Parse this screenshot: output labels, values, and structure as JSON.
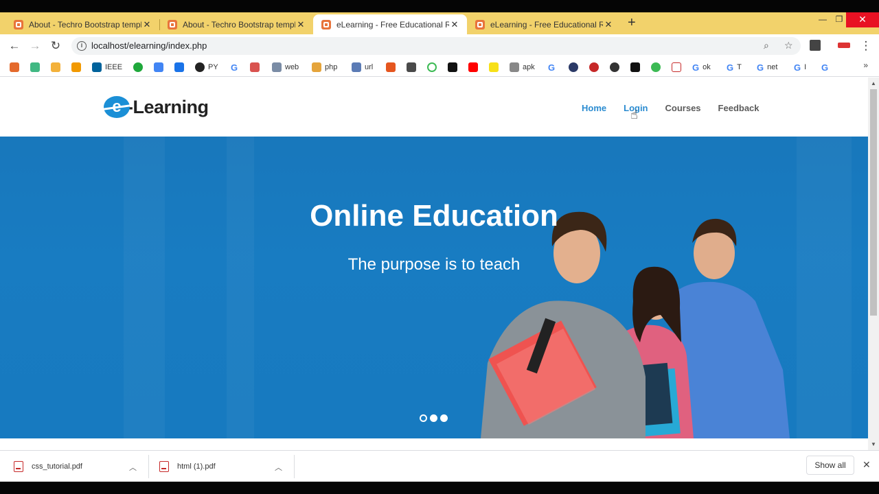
{
  "browser": {
    "tabs": [
      {
        "title": "About - Techro Bootstrap template",
        "active": false
      },
      {
        "title": "About - Techro Bootstrap template",
        "active": false
      },
      {
        "title": "eLearning - Free Educational Res",
        "active": true
      },
      {
        "title": "eLearning - Free Educational Res",
        "active": false
      }
    ],
    "url": "localhost/elearning/index.php",
    "bookmarks": [
      "IEEE",
      "PY",
      "web",
      "php",
      "url",
      "apk",
      "ok",
      "T",
      "net",
      "I"
    ]
  },
  "site": {
    "logo_letter": "e",
    "logo_text": "-Learning",
    "nav": {
      "home": "Home",
      "login": "Login",
      "courses": "Courses",
      "feedback": "Feedback"
    },
    "hero": {
      "title": "Online Education",
      "subtitle": "The purpose is to teach",
      "slide_count": 3,
      "active_slide": 1
    }
  },
  "downloads": {
    "items": [
      {
        "name": "css_tutorial.pdf"
      },
      {
        "name": "html (1).pdf"
      }
    ],
    "show_all_label": "Show all"
  },
  "colors": {
    "accent": "#2a8bd0",
    "hero_bg": "#1a7fc5",
    "tabbar": "#f2d26b"
  }
}
